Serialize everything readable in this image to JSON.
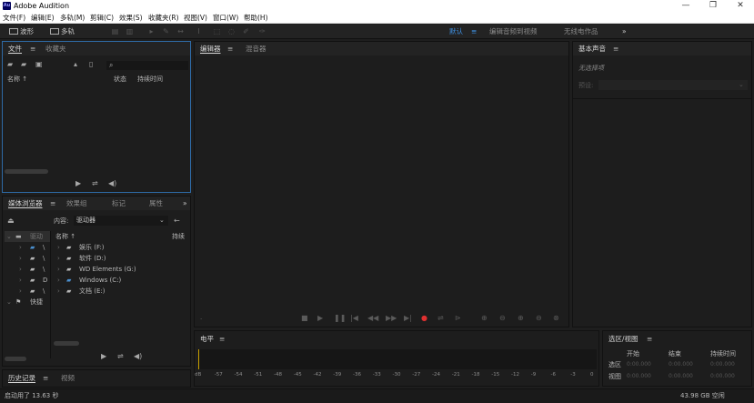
{
  "app": {
    "icon_text": "Au",
    "title": "Adobe Audition"
  },
  "window_controls": {
    "minimize": "—",
    "maximize": "❐",
    "close": "✕"
  },
  "menu": [
    "文件(F)",
    "编辑(E)",
    "多轨(M)",
    "剪辑(C)",
    "效果(S)",
    "收藏夹(R)",
    "视图(V)",
    "窗口(W)",
    "帮助(H)"
  ],
  "toolbar": {
    "waveform_label": "波形",
    "multitrack_label": "多轨",
    "workspaces": [
      "默认",
      "编辑音频到视频",
      "无线电作品"
    ],
    "workspace_menu": "≡",
    "more": "»"
  },
  "files_panel": {
    "tabs": [
      "文件",
      "收藏夹"
    ],
    "menu": "≡",
    "search_icon": "⌕",
    "columns": [
      "名称 ↑",
      "状态",
      "持续时间"
    ]
  },
  "media_panel": {
    "tabs": [
      "媒体浏览器",
      "效果组",
      "标记",
      "属性"
    ],
    "menu": "≡",
    "more": "»",
    "content_label": "内容:",
    "content_value": "驱动器",
    "tree_left": [
      "驱动",
      "\\",
      "\\",
      "\\",
      "D",
      "\\",
      "快捷"
    ],
    "list_header": "名称 ↑",
    "list_duration": "持续",
    "drives": [
      "娱乐 (F:)",
      "软件 (D:)",
      "WD Elements (G:)",
      "Windows (C:)",
      "文档 (E:)"
    ]
  },
  "history_panel": {
    "tabs": [
      "历史记录",
      "视频"
    ],
    "menu": "≡"
  },
  "editor": {
    "tabs": [
      "编辑器",
      "混音器"
    ],
    "menu": "≡"
  },
  "essential_sound": {
    "title": "基本声音",
    "menu": "≡",
    "no_selection": "无选择项",
    "preset_label": "预设:"
  },
  "levels": {
    "title": "电平",
    "menu": "≡",
    "scale": [
      "dB",
      "-57",
      "-54",
      "-51",
      "-48",
      "-45",
      "-42",
      "-39",
      "-36",
      "-33",
      "-30",
      "-27",
      "-24",
      "-21",
      "-18",
      "-15",
      "-12",
      "-9",
      "-6",
      "-3",
      "0"
    ]
  },
  "selection_view": {
    "title": "选区/视图",
    "menu": "≡",
    "headers": [
      "开始",
      "结束",
      "持续时间"
    ],
    "rows": [
      {
        "label": "选区",
        "values": [
          "0:00.000",
          "0:00.000",
          "0:00.000"
        ]
      },
      {
        "label": "视图",
        "values": [
          "0:00.000",
          "0:00.000",
          "0:00.000"
        ]
      }
    ]
  },
  "status": {
    "left": "启动用了 13.63 秒",
    "right": "43.98 GB 空闲"
  },
  "colors": {
    "accent": "#3e8fe0",
    "record": "#e03030",
    "bg": "#1e1e1e"
  }
}
